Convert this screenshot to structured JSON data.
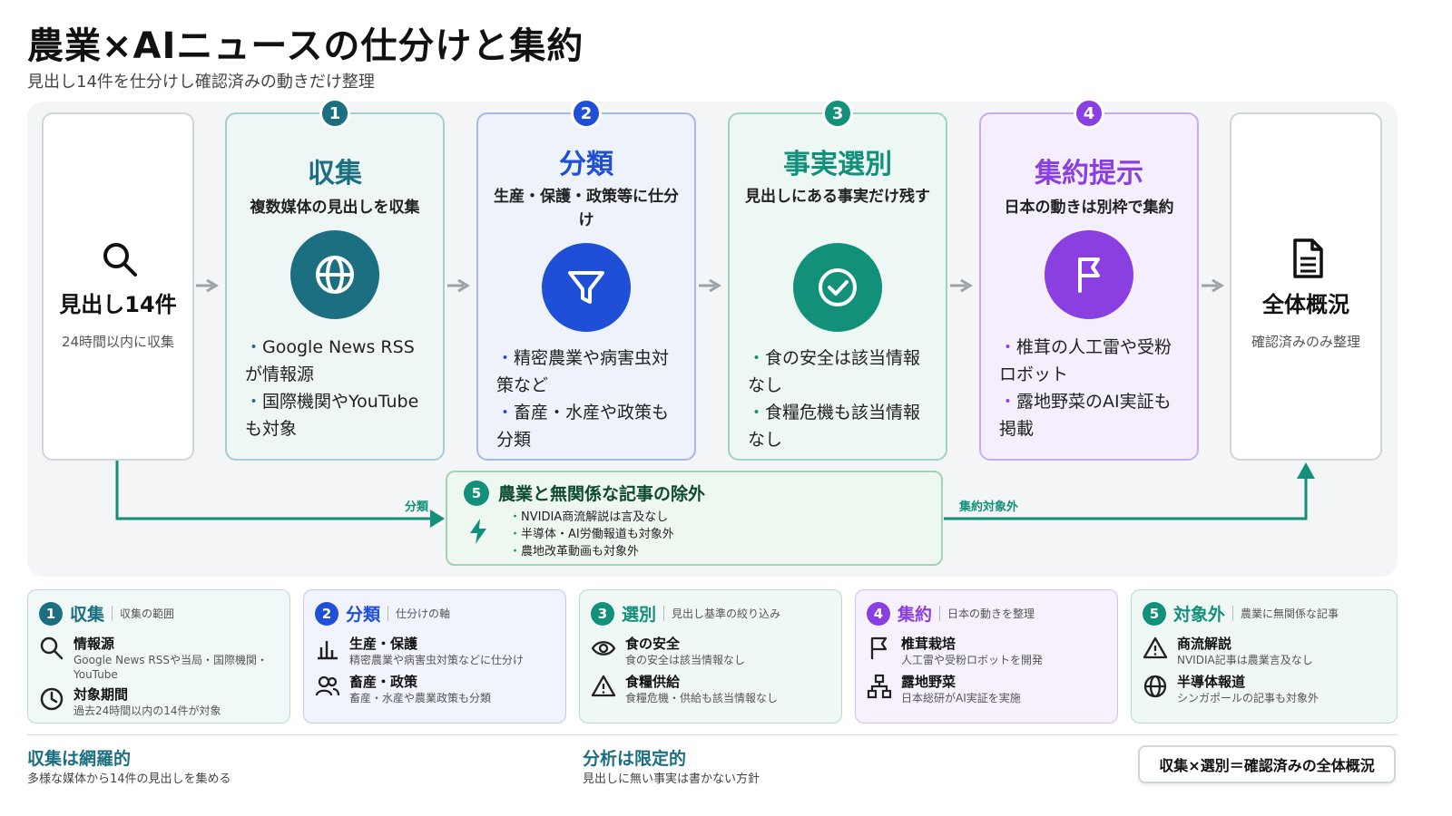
{
  "title": "農業×AIニュースの仕分けと集約",
  "subtitle": "見出し14件を仕分けし確認済みの動きだけ整理",
  "start": {
    "title": "見出し14件",
    "sub": "24時間以内に収集",
    "icon": "search-icon"
  },
  "end": {
    "title": "全体概況",
    "sub": "確認済みのみ整理",
    "icon": "document-icon"
  },
  "stages": [
    {
      "num": "1",
      "title": "収集",
      "desc": "複数媒体の見出しを収集",
      "icon": "globe-icon",
      "color": "#1b6f80",
      "bullets": [
        "Google News RSSが情報源",
        "国際機関やYouTubeも対象"
      ]
    },
    {
      "num": "2",
      "title": "分類",
      "desc": "生産・保護・政策等に仕分け",
      "icon": "filter-icon",
      "color": "#1f4fd6",
      "bullets": [
        "精密農業や病害虫対策など",
        "畜産・水産や政策も分類"
      ]
    },
    {
      "num": "3",
      "title": "事実選別",
      "desc": "見出しにある事実だけ残す",
      "icon": "check-circle-icon",
      "color": "#12907a",
      "bullets": [
        "食の安全は該当情報なし",
        "食糧危機も該当情報なし"
      ]
    },
    {
      "num": "4",
      "title": "集約提示",
      "desc": "日本の動きは別枠で集約",
      "icon": "flag-icon",
      "color": "#8a3fe0",
      "bullets": [
        "椎茸の人工雷や受粉ロボット",
        "露地野菜のAI実証も掲載"
      ]
    }
  ],
  "exclude": {
    "num": "5",
    "title": "農業と無関係な記事の除外",
    "icon": "lightning-icon",
    "items": [
      "NVIDIA商流解説は言及なし",
      "半導体・AI労働報道も対象外",
      "農地改革動画も対象外"
    ],
    "left_label": "分類",
    "right_label": "集約対象外"
  },
  "legend": [
    {
      "num": "1",
      "title": "収集",
      "sub": "収集の範囲",
      "color": "#1b6f80",
      "bg": "#f1f8f8",
      "items": [
        {
          "icon": "search-icon",
          "name": "情報源",
          "desc": "Google News RSSや当局・国際機関・YouTube"
        },
        {
          "icon": "clock-icon",
          "name": "対象期間",
          "desc": "過去24時間以内の14件が対象"
        }
      ]
    },
    {
      "num": "2",
      "title": "分類",
      "sub": "仕分けの軸",
      "color": "#1f4fd6",
      "bg": "#f1f4fc",
      "items": [
        {
          "icon": "bar-chart-icon",
          "name": "生産・保護",
          "desc": "精密農業や病害虫対策などに仕分け"
        },
        {
          "icon": "users-icon",
          "name": "畜産・政策",
          "desc": "畜産・水産や農業政策も分類"
        }
      ]
    },
    {
      "num": "3",
      "title": "選別",
      "sub": "見出し基準の絞り込み",
      "color": "#12907a",
      "bg": "#f0f8f5",
      "items": [
        {
          "icon": "eye-icon",
          "name": "食の安全",
          "desc": "食の安全は該当情報なし"
        },
        {
          "icon": "warning-icon",
          "name": "食糧供給",
          "desc": "食糧危機・供給も該当情報なし"
        }
      ]
    },
    {
      "num": "4",
      "title": "集約",
      "sub": "日本の動きを整理",
      "color": "#8a3fe0",
      "bg": "#f6f1fd",
      "items": [
        {
          "icon": "flag-icon",
          "name": "椎茸栽培",
          "desc": "人工雷や受粉ロボットを開発"
        },
        {
          "icon": "hierarchy-icon",
          "name": "露地野菜",
          "desc": "日本総研がAI実証を実施"
        }
      ]
    },
    {
      "num": "5",
      "title": "対象外",
      "sub": "農業に無関係な記事",
      "color": "#12907a",
      "bg": "#f0f8f5",
      "items": [
        {
          "icon": "warning-icon",
          "name": "商流解説",
          "desc": "NVIDIA記事は農業言及なし"
        },
        {
          "icon": "globe-icon",
          "name": "半導体報道",
          "desc": "シンガポールの記事も対象外"
        }
      ]
    }
  ],
  "footer": {
    "left_title": "収集は網羅的",
    "left_sub": "多様な媒体から14件の見出しを集める",
    "mid_title": "分析は限定的",
    "mid_sub": "見出しに無い事実は書かない方針",
    "badge": "収集×選別＝確認済みの全体概況",
    "accent": "#1b6f80"
  }
}
